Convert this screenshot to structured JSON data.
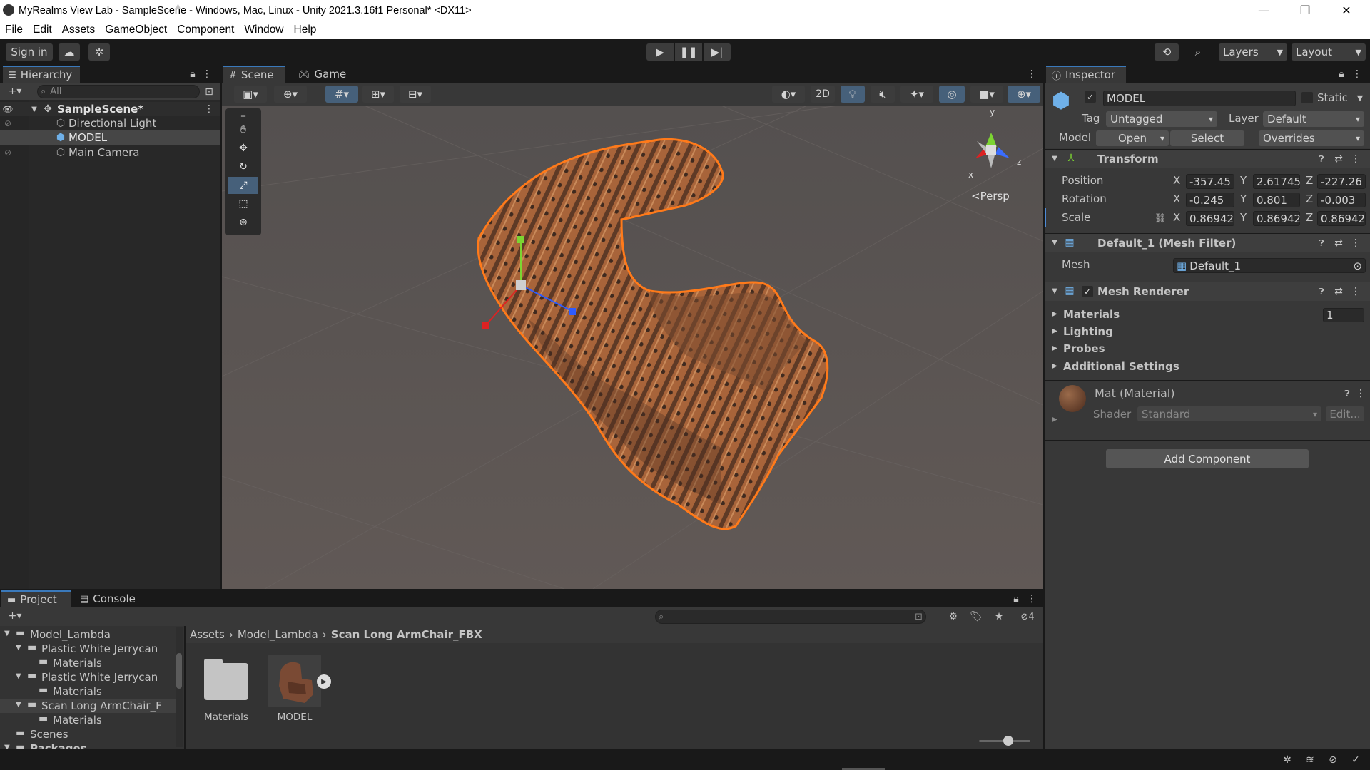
{
  "window": {
    "title": "MyRealms View Lab - SampleScene - Windows, Mac, Linux - Unity 2021.3.16f1 Personal* <DX11>"
  },
  "menu": [
    "File",
    "Edit",
    "Assets",
    "GameObject",
    "Component",
    "Window",
    "Help"
  ],
  "toolbar": {
    "sign_in": "Sign in",
    "layers": "Layers",
    "layout": "Layout"
  },
  "hierarchy": {
    "tab": "Hierarchy",
    "search_placeholder": "All",
    "scene": "SampleScene*",
    "items": [
      "Directional Light",
      "MODEL",
      "Main Camera"
    ]
  },
  "scene_view": {
    "tabs": [
      "Scene",
      "Game"
    ],
    "mode_2d": "2D",
    "persp": "<Persp",
    "gizmo_axes": {
      "x": "x",
      "y": "y",
      "z": "z"
    }
  },
  "inspector": {
    "tab": "Inspector",
    "object_name": "MODEL",
    "static_label": "Static",
    "tag_label": "Tag",
    "tag_value": "Untagged",
    "layer_label": "Layer",
    "layer_value": "Default",
    "model_label": "Model",
    "open": "Open",
    "select": "Select",
    "overrides": "Overrides",
    "transform": {
      "title": "Transform",
      "position": {
        "label": "Position",
        "x": "-357.45",
        "y": "2.61745",
        "z": "-227.26"
      },
      "rotation": {
        "label": "Rotation",
        "x": "-0.245",
        "y": "0.801",
        "z": "-0.003"
      },
      "scale": {
        "label": "Scale",
        "x": "0.86942",
        "y": "0.86942",
        "z": "0.86942"
      }
    },
    "mesh_filter": {
      "title": "Default_1 (Mesh Filter)",
      "mesh_label": "Mesh",
      "mesh_value": "Default_1"
    },
    "mesh_renderer": {
      "title": "Mesh Renderer",
      "sections": [
        "Materials",
        "Lighting",
        "Probes",
        "Additional Settings"
      ],
      "materials_count": "1"
    },
    "material": {
      "title": "Mat (Material)",
      "shader_label": "Shader",
      "shader_value": "Standard",
      "edit": "Edit..."
    },
    "add_component": "Add Component"
  },
  "project": {
    "tabs": [
      "Project",
      "Console"
    ],
    "tree": [
      {
        "label": "Model_Lambda",
        "indent": 0
      },
      {
        "label": "Plastic White Jerrycan",
        "indent": 1
      },
      {
        "label": "Materials",
        "indent": 2
      },
      {
        "label": "Plastic White Jerrycan",
        "indent": 1
      },
      {
        "label": "Materials",
        "indent": 2
      },
      {
        "label": "Scan Long ArmChair_F",
        "indent": 1
      },
      {
        "label": "Materials",
        "indent": 2
      },
      {
        "label": "Scenes",
        "indent": 0
      },
      {
        "label": "Packages",
        "indent": 0
      }
    ],
    "breadcrumb": [
      "Assets",
      "Model_Lambda",
      "Scan Long ArmChair_FBX"
    ],
    "assets": [
      "Materials",
      "MODEL"
    ],
    "hidden_count": "4"
  }
}
